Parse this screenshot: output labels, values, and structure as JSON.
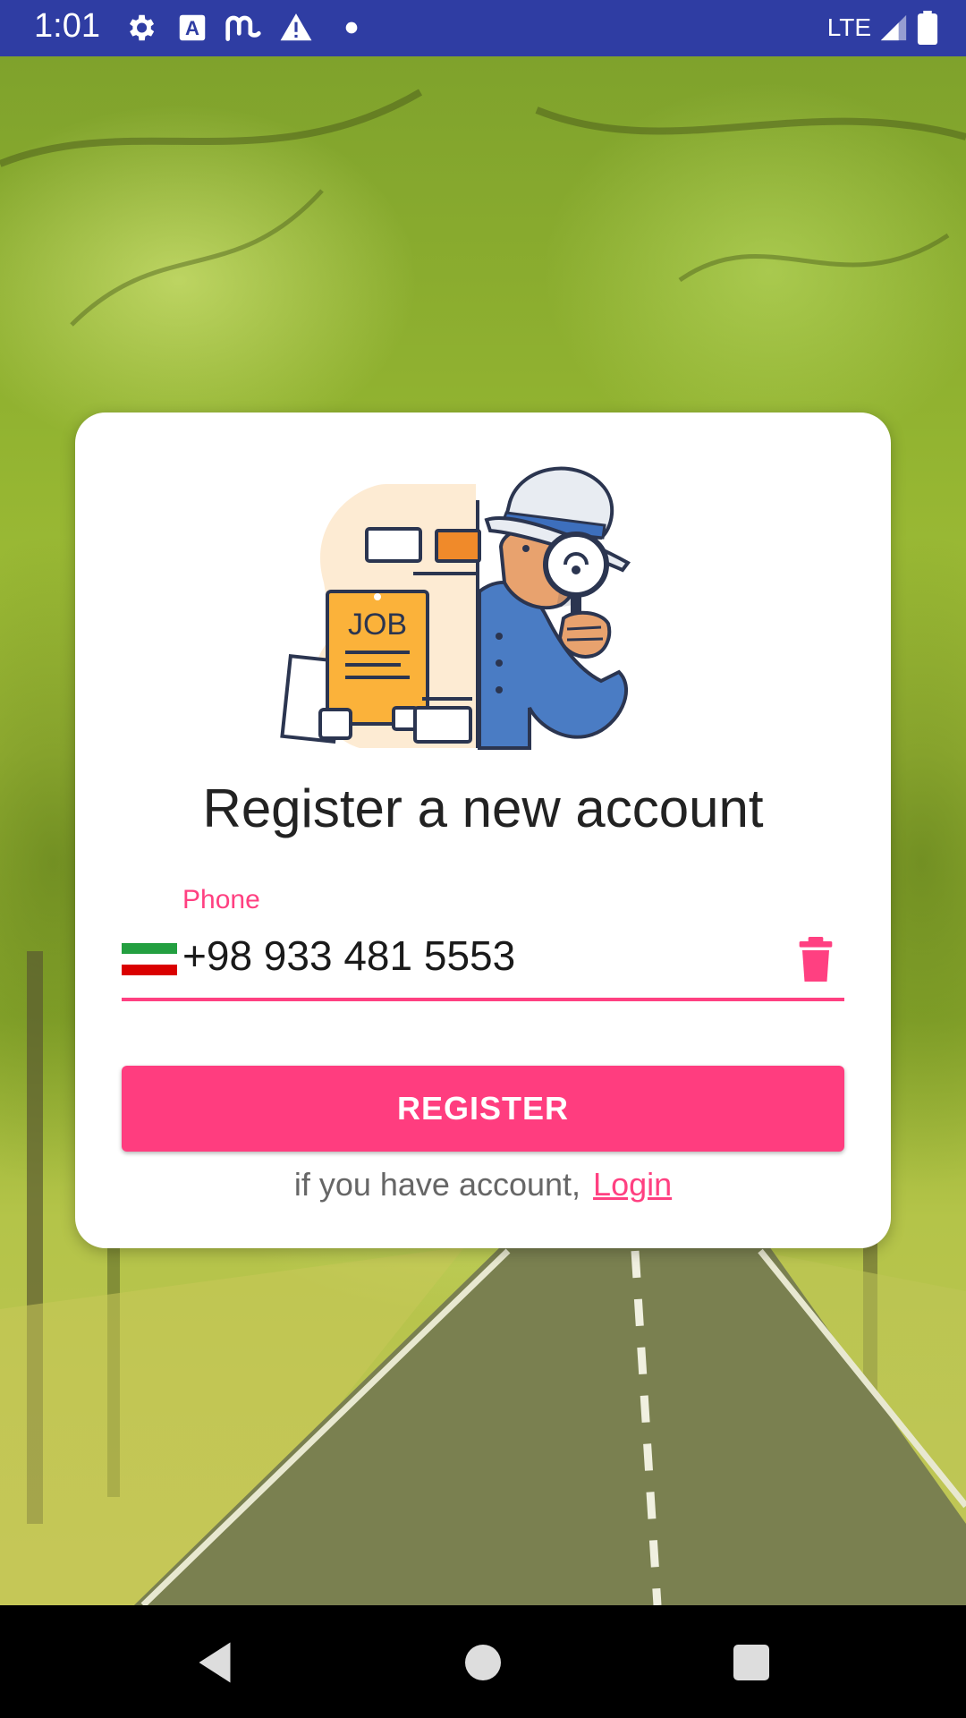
{
  "status_bar": {
    "time": "1:01",
    "network": "LTE",
    "icons": [
      "gear-icon",
      "a-box-icon",
      "m-logo-icon",
      "warning-icon",
      "dot-icon",
      "signal-icon",
      "battery-icon"
    ]
  },
  "register_card": {
    "illustration_text": "JOB",
    "title": "Register a new account",
    "phone": {
      "label": "Phone",
      "value": "+98 933 481 5553",
      "flag": "iran-flag-icon"
    },
    "register_button": "REGISTER",
    "login_prompt": "if you have account,",
    "login_link": "Login"
  },
  "colors": {
    "accent": "#ff4081",
    "button": "#ff3d7f",
    "status_bar": "#2f3da3"
  },
  "nav_bar": {
    "icons": [
      "back-icon",
      "home-icon",
      "recents-icon"
    ]
  }
}
